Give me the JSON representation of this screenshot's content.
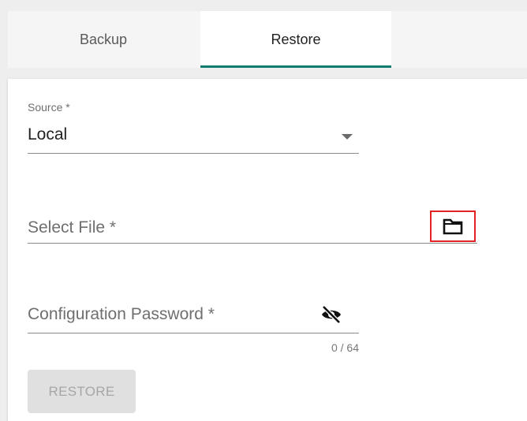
{
  "tabs": {
    "backup_label": "Backup",
    "restore_label": "Restore",
    "active": "Restore",
    "accent_color": "#0f7c6e"
  },
  "form": {
    "source": {
      "label": "Source *",
      "value": "Local",
      "icon": "chevron-down-icon"
    },
    "select_file": {
      "label": "Select File *",
      "icon": "folder-icon",
      "highlight_color": "#e02424"
    },
    "password": {
      "label": "Configuration Password *",
      "icon": "eye-off-icon",
      "counter": "0 / 64"
    },
    "restore_button_label": "RESTORE"
  }
}
